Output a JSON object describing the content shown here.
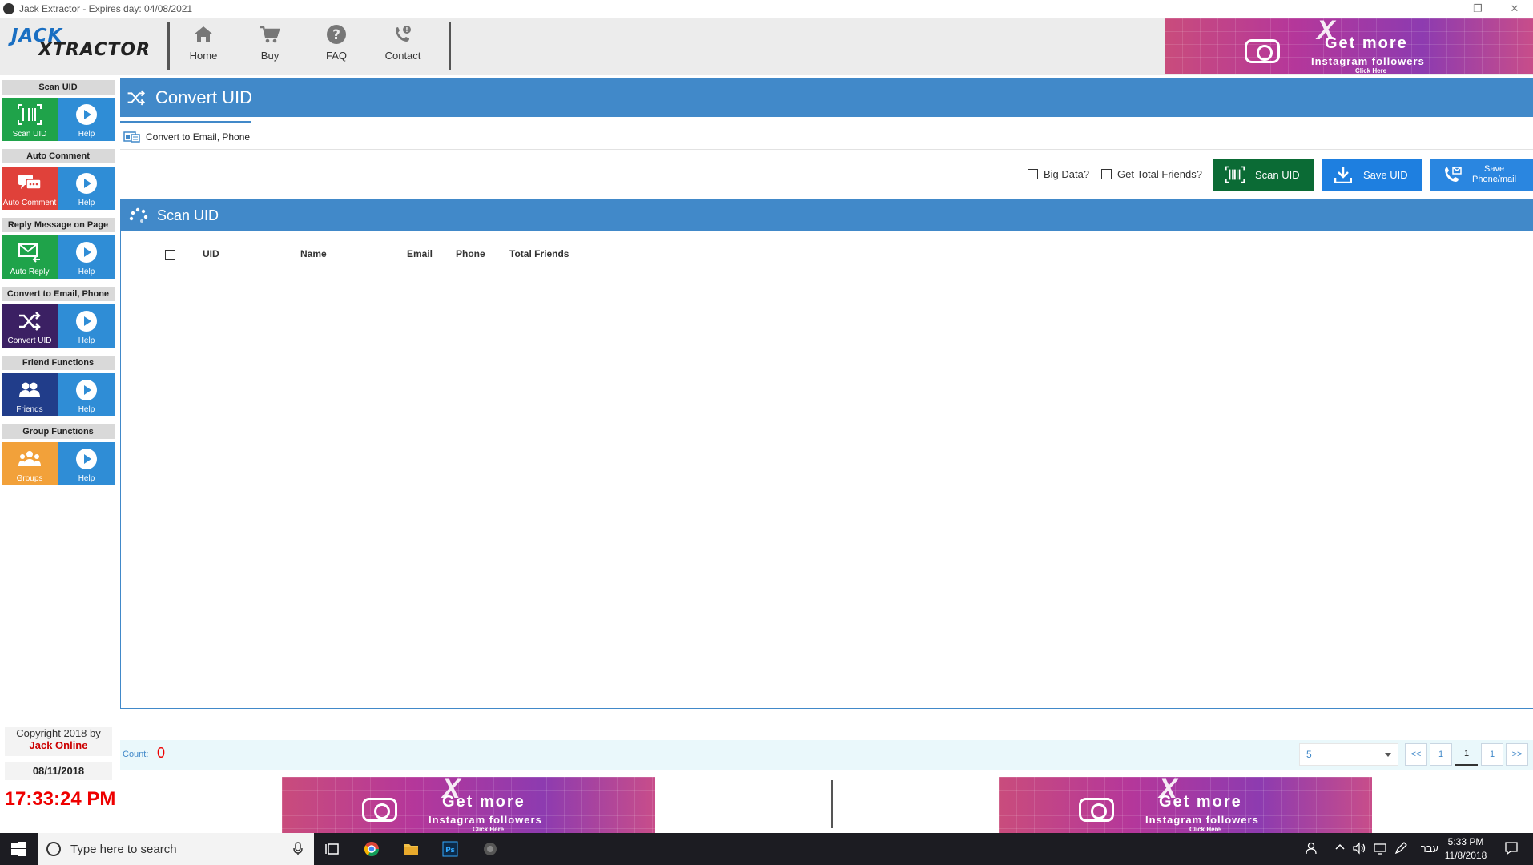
{
  "window": {
    "title": "Jack Extractor - Expires day: 04/08/2021"
  },
  "logo": {
    "line1": "JACK",
    "line2": "XTRACTOR"
  },
  "nav": [
    {
      "label": "Home",
      "icon": "home-icon"
    },
    {
      "label": "Buy",
      "icon": "cart-icon"
    },
    {
      "label": "FAQ",
      "icon": "question-icon"
    },
    {
      "label": "Contact",
      "icon": "phone-icon"
    }
  ],
  "ad": {
    "line1": "Get more",
    "line2": "Instagram followers",
    "line3": "Click Here"
  },
  "sidebar": [
    {
      "header": "Scan UID",
      "tile": "Scan UID",
      "help": "Help",
      "color": "#1fa34a",
      "icon": "barcode-icon"
    },
    {
      "header": "Auto Comment",
      "tile": "Auto Comment",
      "help": "Help",
      "color": "#e0413a",
      "icon": "chat-icon"
    },
    {
      "header": "Reply Message on Page",
      "tile": "Auto Reply",
      "help": "Help",
      "color": "#1fa34a",
      "icon": "mail-reply-icon"
    },
    {
      "header": "Convert to Email, Phone",
      "tile": "Convert UID",
      "help": "Help",
      "color": "#3b2063",
      "icon": "shuffle-icon"
    },
    {
      "header": "Friend Functions",
      "tile": "Friends",
      "help": "Help",
      "color": "#213d8a",
      "icon": "friends-icon"
    },
    {
      "header": "Group Functions",
      "tile": "Groups",
      "help": "Help",
      "color": "#f2a13a",
      "icon": "group-icon"
    }
  ],
  "footer": {
    "copyright": "Copyright 2018 by",
    "author": "Jack Online",
    "date": "08/11/2018",
    "time": "17:33:24 PM"
  },
  "main": {
    "title": "Convert UID",
    "tab": "Convert to Email, Phone",
    "options": {
      "big_data": "Big Data?",
      "total_friends": "Get Total Friends?"
    },
    "buttons": {
      "scan": "Scan UID",
      "save_uid": "Save UID",
      "save_phone_1": "Save",
      "save_phone_2": "Phone/mail"
    },
    "section_title": "Scan UID",
    "columns": [
      "UID",
      "Name",
      "Email",
      "Phone",
      "Total Friends"
    ]
  },
  "countbar": {
    "count_label": "Count:",
    "count_value": "0",
    "page_size": "5",
    "pages": [
      "<<",
      "1",
      "1",
      "1",
      ">>"
    ]
  },
  "taskbar": {
    "search_placeholder": "Type here to search",
    "lang": "עבר",
    "time": "5:33 PM",
    "date": "11/8/2018"
  },
  "colors": {
    "accent": "#4189c9",
    "scan_btn": "#0b6b35",
    "save_btn": "#1e7fe0",
    "alert": "#e00000"
  }
}
